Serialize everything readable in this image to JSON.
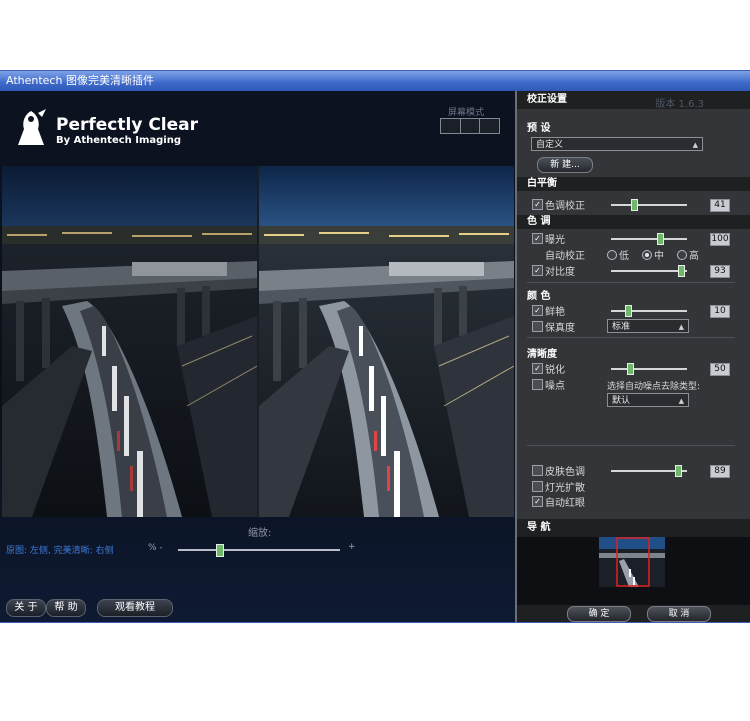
{
  "window": {
    "title": "Athentech 图像完美清晰插件"
  },
  "logo": {
    "title": "Perfectly Clear",
    "subtitle": "By Athentech Imaging"
  },
  "view_mode": {
    "label": "屏幕模式"
  },
  "preview": {
    "zoom_label": "缩放:",
    "compare_text": "原图: 左侧, 完美清晰: 右侧",
    "zoom_minus": "% -",
    "zoom_plus": "+",
    "zoom_level": 0.25
  },
  "bottom_buttons": {
    "about": "关 于",
    "help": "帮 助",
    "tutorial": "观看教程"
  },
  "panel": {
    "header": "校正设置",
    "version": "版本 1.6.3",
    "preset": {
      "title": "预 设",
      "value": "自定义",
      "new_button": "新 建..."
    },
    "white_balance": {
      "title": "白平衡",
      "tint": {
        "label": "色调校正",
        "checked": true,
        "value": "41",
        "level": 0.3
      }
    },
    "tone": {
      "title": "色 调",
      "exposure": {
        "label": "曝光",
        "checked": true,
        "value": "100",
        "level": 0.65
      },
      "auto_correct": {
        "label": "自动校正",
        "options": [
          "低",
          "中",
          "高"
        ],
        "selected": "中"
      },
      "contrast": {
        "label": "对比度",
        "checked": true,
        "value": "93",
        "level": 0.92
      }
    },
    "color": {
      "title": "颜 色",
      "vibrance": {
        "label": "鲜艳",
        "checked": true,
        "value": "10",
        "level": 0.22
      },
      "fidelity": {
        "label": "保真度",
        "checked": false,
        "select_value": "标准"
      }
    },
    "sharpness": {
      "title": "清晰度",
      "sharpen": {
        "label": "锐化",
        "checked": true,
        "value": "50",
        "level": 0.25
      },
      "noise": {
        "label": "噪点",
        "checked": false,
        "select_label": "选择自动噪点去除类型:",
        "select_value": "默认"
      }
    },
    "extras": {
      "skin_tone": {
        "label": "皮肤色调",
        "checked": false,
        "value": "89",
        "level": 0.88
      },
      "light_diffusion": {
        "label": "灯光扩散",
        "checked": false
      },
      "red_eye": {
        "label": "自动红眼",
        "checked": true
      }
    },
    "navigation": {
      "title": "导 航"
    },
    "confirm": "确 定",
    "cancel": "取 消"
  },
  "colors": {
    "accent_green": "#6fb86a",
    "link_blue": "#3f7ad6",
    "title_bar": "#3d69c9"
  }
}
